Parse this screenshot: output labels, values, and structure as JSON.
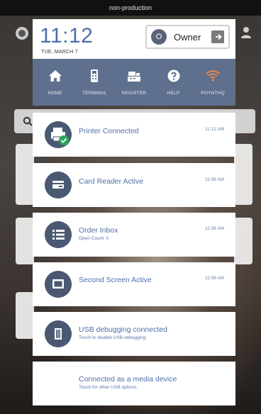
{
  "status_bar": {
    "label": "non-production"
  },
  "header": {
    "time": "11:12",
    "date": "TUE, MARCH 7",
    "user": {
      "initial": "O",
      "name": "Owner"
    }
  },
  "nav": [
    {
      "label": "HOME",
      "icon": "home-icon"
    },
    {
      "label": "TERMINAL",
      "icon": "terminal-icon"
    },
    {
      "label": "REGISTER",
      "icon": "register-icon"
    },
    {
      "label": "HELP",
      "icon": "help-icon"
    },
    {
      "label": "POYNTHQ",
      "icon": "wifi-icon"
    }
  ],
  "notifications": [
    {
      "title": "Printer Connected",
      "subtitle": "",
      "time": "11:12 AM",
      "icon": "printer-icon"
    },
    {
      "title": "Card Reader Active",
      "subtitle": "",
      "time": "11:08 AM",
      "icon": "card-reader-icon"
    },
    {
      "title": "Order Inbox",
      "subtitle": "Open Count: 0",
      "time": "11:08 AM",
      "icon": "list-icon"
    },
    {
      "title": "Second Screen Active",
      "subtitle": "",
      "time": "11:08 AM",
      "icon": "screen-icon"
    },
    {
      "title": "USB debugging connected",
      "subtitle": "Touch to disable USB debugging.",
      "time": "",
      "icon": "usb-icon"
    },
    {
      "title": "Connected as a media device",
      "subtitle": "Touch for other USB options.",
      "time": "",
      "icon": ""
    }
  ],
  "colors": {
    "nav_bg": "#5f6f8e",
    "accent_blue": "#4d6fa8",
    "icon_circle": "#4a5872",
    "poynthq_orange": "#e58a4e"
  }
}
